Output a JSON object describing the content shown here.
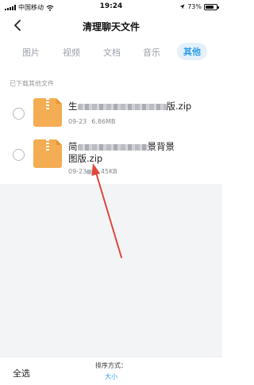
{
  "status_bar": {
    "carrier": "中国移动",
    "time": "19:24",
    "battery_percent": "73%"
  },
  "header": {
    "title": "清理聊天文件",
    "back_icon": "chevron-left-icon"
  },
  "tabs": [
    {
      "label": "图片",
      "active": false
    },
    {
      "label": "视频",
      "active": false
    },
    {
      "label": "文档",
      "active": false
    },
    {
      "label": "音乐",
      "active": false
    },
    {
      "label": "其他",
      "active": true
    }
  ],
  "section_title": "已下载其他文件",
  "files": [
    {
      "name_start": "生",
      "name_end": "版.zip",
      "name_line2": "",
      "date": "09-23",
      "size": "6.86MB",
      "icon": "zip-file-icon"
    },
    {
      "name_start": "简",
      "name_end": "景背景",
      "name_line2": "图版.zip",
      "date": "09-23",
      "size": "1.45KB",
      "icon": "zip-file-icon"
    }
  ],
  "bottom_bar": {
    "select_all": "全选",
    "sort_label": "排序方式：",
    "sort_value": "大小"
  },
  "colors": {
    "accent": "#2a9de6",
    "zip_icon": "#f4ad52",
    "annotation_arrow": "#e0463c"
  }
}
